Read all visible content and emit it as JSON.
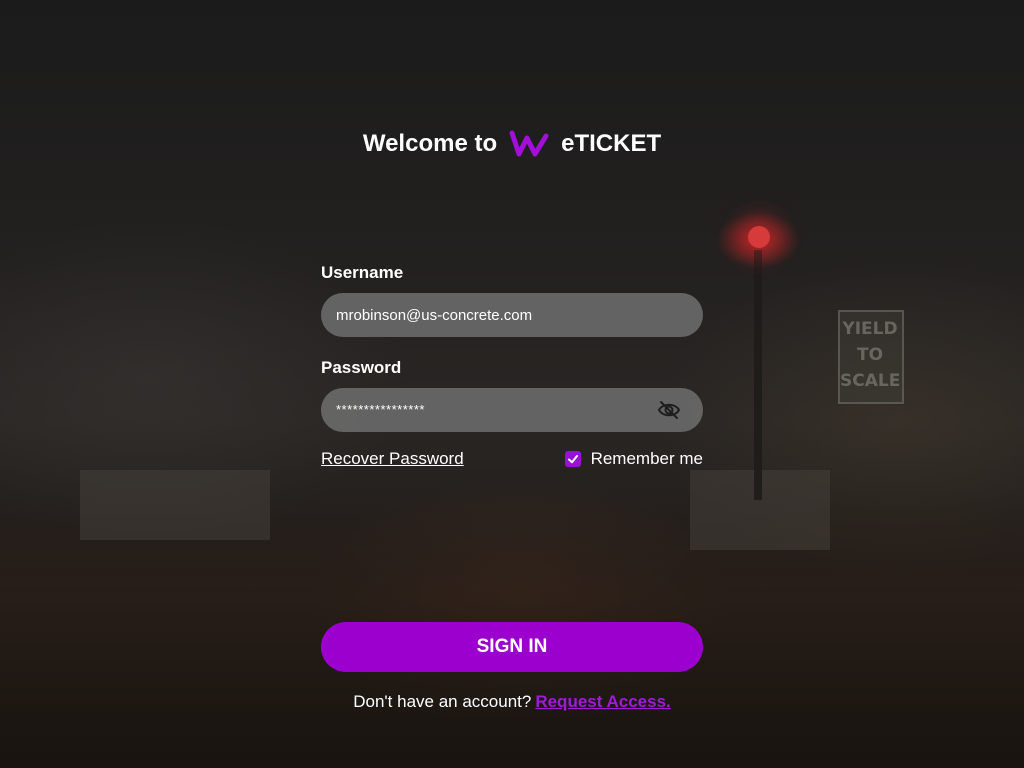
{
  "header": {
    "welcome_text": "Welcome to",
    "brand_name": "eTICKET",
    "logo_icon": "w-wave-logo-icon"
  },
  "background": {
    "sign_text": "YIELD TO SCALE"
  },
  "login_form": {
    "username_label": "Username",
    "username_value": "mrobinson@us-concrete.com",
    "password_label": "Password",
    "password_masked": "****************",
    "password_toggle_icon": "eye-slash-icon",
    "recover_password_label": "Recover Password",
    "remember_me_label": "Remember me",
    "remember_me_checked": true,
    "sign_in_label": "SIGN IN"
  },
  "footer": {
    "prompt_text": "Don't have an account?",
    "request_access_label": "Request Access."
  },
  "colors": {
    "accent": "#9b00cf",
    "link_accent": "#a21ad8",
    "field_bg": "#6e6e6e",
    "text": "#ffffff"
  }
}
